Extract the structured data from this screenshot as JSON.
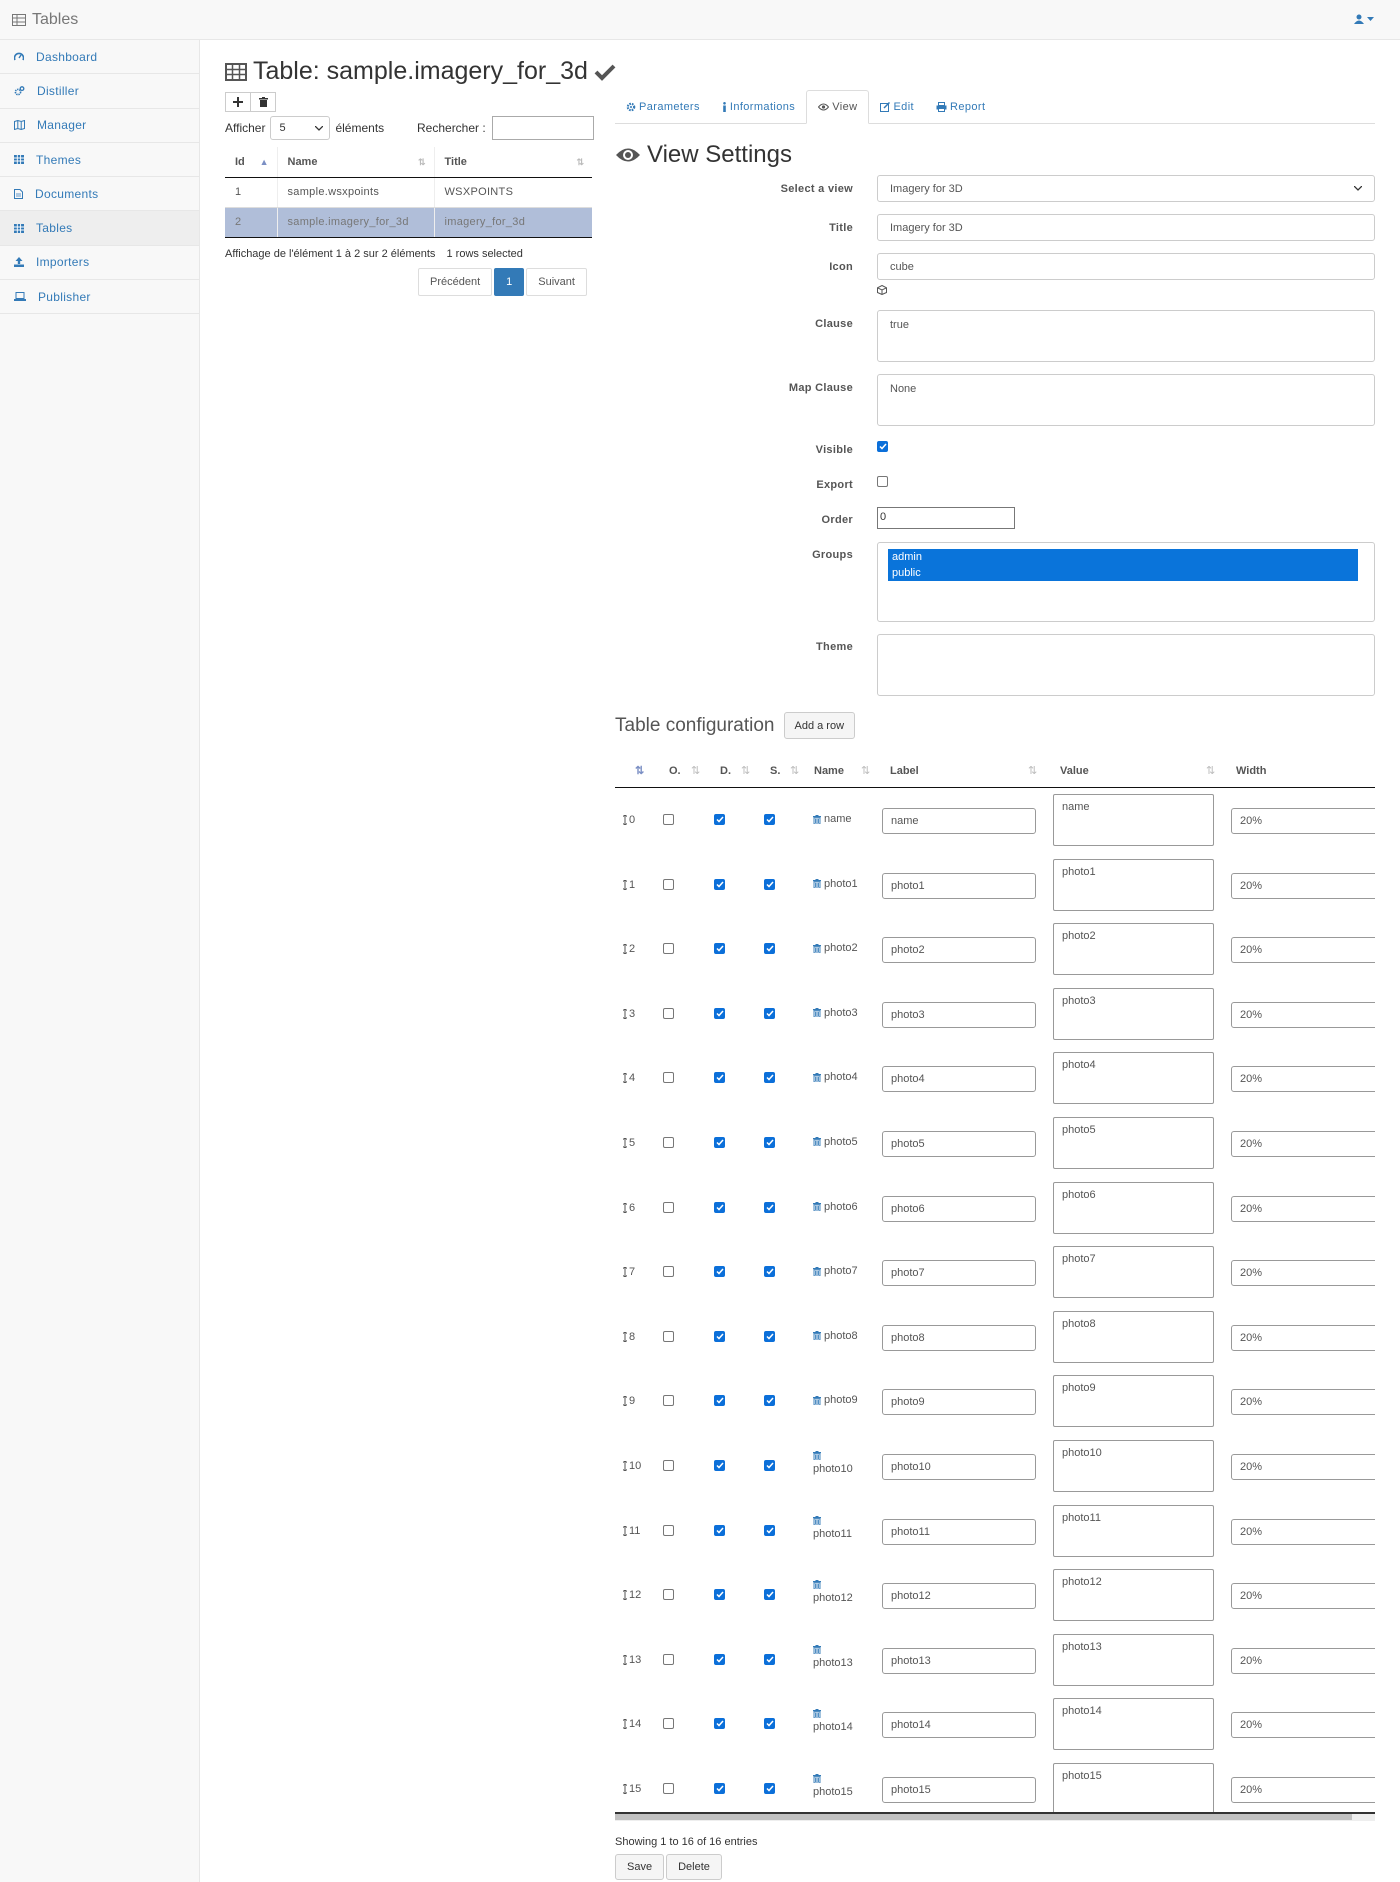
{
  "app": {
    "title": "Tables"
  },
  "sidebar": {
    "items": [
      {
        "label": "Dashboard",
        "icon": "dashboard-icon"
      },
      {
        "label": "Distiller",
        "icon": "cogs-icon"
      },
      {
        "label": "Manager",
        "icon": "map-icon"
      },
      {
        "label": "Themes",
        "icon": "grid-icon"
      },
      {
        "label": "Documents",
        "icon": "document-icon"
      },
      {
        "label": "Tables",
        "icon": "table-icon",
        "active": true
      },
      {
        "label": "Importers",
        "icon": "upload-icon"
      },
      {
        "label": "Publisher",
        "icon": "laptop-icon"
      }
    ]
  },
  "page": {
    "title": "Table: sample.imagery_for_3d"
  },
  "list": {
    "length_prefix": "Afficher",
    "length_value": "5",
    "length_suffix": "éléments",
    "search_label": "Rechercher :",
    "columns": [
      "Id",
      "Name",
      "Title"
    ],
    "rows": [
      {
        "id": "1",
        "name": "sample.wsxpoints",
        "title": "WSXPOINTS",
        "selected": false
      },
      {
        "id": "2",
        "name": "sample.imagery_for_3d",
        "title": "imagery_for_3d",
        "selected": true
      }
    ],
    "info": "Affichage de l'élément 1 à 2 sur 2 éléments",
    "selected_info": "1 rows selected",
    "prev": "Précédent",
    "page": "1",
    "next": "Suivant"
  },
  "tabs": [
    {
      "label": "Parameters",
      "active": false
    },
    {
      "label": "Informations",
      "active": false
    },
    {
      "label": "View",
      "active": true
    },
    {
      "label": "Edit",
      "active": false
    },
    {
      "label": "Report",
      "active": false
    }
  ],
  "view": {
    "heading": "View Settings",
    "select_label": "Select a view",
    "select_value": "Imagery for 3D",
    "title_label": "Title",
    "title_value": "Imagery for 3D",
    "icon_label": "Icon",
    "icon_value": "cube",
    "clause_label": "Clause",
    "clause_value": "true",
    "map_clause_label": "Map Clause",
    "map_clause_value": "None",
    "visible_label": "Visible",
    "visible": true,
    "export_label": "Export",
    "export": false,
    "order_label": "Order",
    "order_value": "0",
    "groups_label": "Groups",
    "groups": [
      "admin",
      "public"
    ],
    "theme_label": "Theme"
  },
  "config": {
    "heading": "Table configuration",
    "add_row": "Add a row",
    "columns": [
      "O.",
      "D.",
      "S.",
      "Name",
      "Label",
      "Value",
      "Width"
    ],
    "rows": [
      {
        "idx": "0",
        "name": "name",
        "label": "name",
        "value": "name",
        "width": "20%"
      },
      {
        "idx": "1",
        "name": "photo1",
        "label": "photo1",
        "value": "photo1",
        "width": "20%"
      },
      {
        "idx": "2",
        "name": "photo2",
        "label": "photo2",
        "value": "photo2",
        "width": "20%"
      },
      {
        "idx": "3",
        "name": "photo3",
        "label": "photo3",
        "value": "photo3",
        "width": "20%"
      },
      {
        "idx": "4",
        "name": "photo4",
        "label": "photo4",
        "value": "photo4",
        "width": "20%"
      },
      {
        "idx": "5",
        "name": "photo5",
        "label": "photo5",
        "value": "photo5",
        "width": "20%"
      },
      {
        "idx": "6",
        "name": "photo6",
        "label": "photo6",
        "value": "photo6",
        "width": "20%"
      },
      {
        "idx": "7",
        "name": "photo7",
        "label": "photo7",
        "value": "photo7",
        "width": "20%"
      },
      {
        "idx": "8",
        "name": "photo8",
        "label": "photo8",
        "value": "photo8",
        "width": "20%"
      },
      {
        "idx": "9",
        "name": "photo9",
        "label": "photo9",
        "value": "photo9",
        "width": "20%"
      },
      {
        "idx": "10",
        "name": "photo10",
        "label": "photo10",
        "value": "photo10",
        "width": "20%"
      },
      {
        "idx": "11",
        "name": "photo11",
        "label": "photo11",
        "value": "photo11",
        "width": "20%"
      },
      {
        "idx": "12",
        "name": "photo12",
        "label": "photo12",
        "value": "photo12",
        "width": "20%"
      },
      {
        "idx": "13",
        "name": "photo13",
        "label": "photo13",
        "value": "photo13",
        "width": "20%"
      },
      {
        "idx": "14",
        "name": "photo14",
        "label": "photo14",
        "value": "photo14",
        "width": "20%"
      },
      {
        "idx": "15",
        "name": "photo15",
        "label": "photo15",
        "value": "photo15",
        "width": "20%"
      }
    ],
    "info": "Showing 1 to 16 of 16 entries",
    "save": "Save",
    "delete": "Delete"
  },
  "colors": {
    "accent": "#337ab7",
    "selected_row": "#b0bed9",
    "group_option": "#0a74da",
    "checkbox_on": "#0b6fd9"
  }
}
